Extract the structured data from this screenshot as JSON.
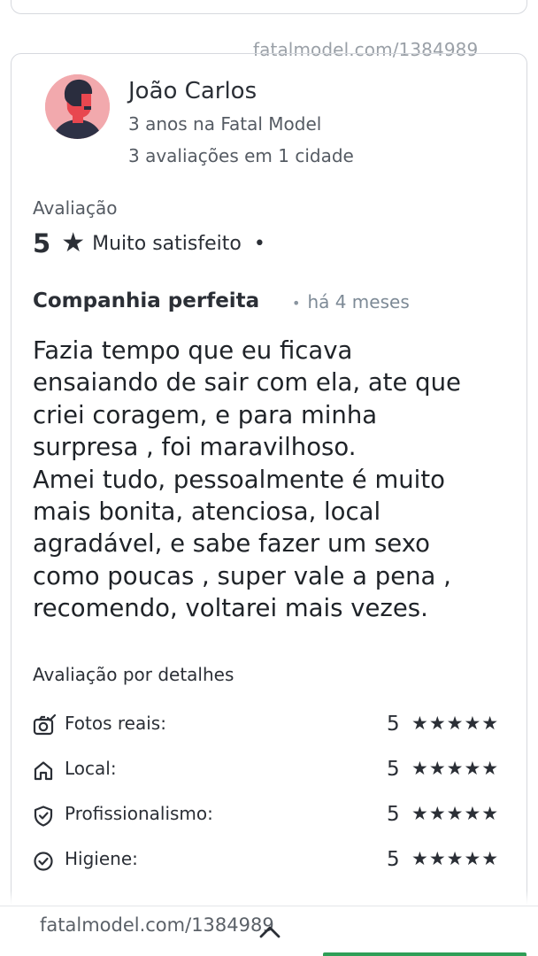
{
  "watermark": {
    "top": "fatalmodel.com/1384989",
    "bottom": "fatalmodel.com/1384989"
  },
  "user": {
    "name": "João Carlos",
    "tenure": "3 anos na Fatal Model",
    "reviews": "3 avaliações em 1 cidade"
  },
  "rating": {
    "label": "Avaliação",
    "score": "5",
    "star": "★",
    "text": "Muito satisfeito",
    "separator": "•"
  },
  "review": {
    "title": "Companhia perfeita",
    "time_separator": "•",
    "time": "há 4 meses",
    "body_lines": [
      "Fazia tempo que eu ficava",
      "ensaiando de sair com ela, ate que",
      "criei coragem, e para minha",
      "surpresa , foi maravilhoso.",
      "Amei tudo, pessoalmente é muito",
      "mais bonita, atenciosa, local",
      "agradável, e sabe fazer um sexo",
      "como poucas , super vale a pena ,",
      "recomendo, voltarei mais vezes."
    ]
  },
  "details": {
    "label": "Avaliação por detalhes",
    "items": [
      {
        "icon": "camera-check-icon",
        "label": "Fotos reais:",
        "score": "5",
        "stars": "★★★★★"
      },
      {
        "icon": "home-icon",
        "label": "Local:",
        "score": "5",
        "stars": "★★★★★"
      },
      {
        "icon": "shield-check-icon",
        "label": "Profissionalismo:",
        "score": "5",
        "stars": "★★★★★"
      },
      {
        "icon": "circle-check-icon",
        "label": "Higiene:",
        "score": "5",
        "stars": "★★★★★"
      }
    ]
  },
  "colors": {
    "text": "#2b2f36",
    "muted": "#555b63",
    "time": "#7d8a96",
    "border": "#d6d9de",
    "avatar_bg": "#f2a9ad",
    "accent_green": "#2f9e57"
  }
}
